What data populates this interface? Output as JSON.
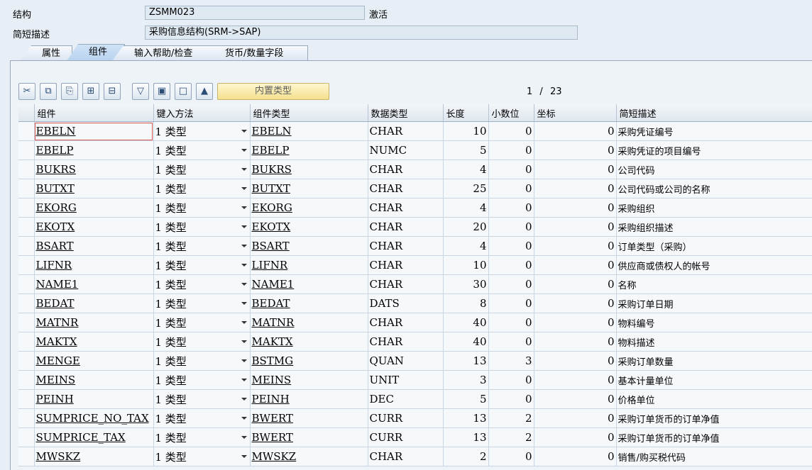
{
  "header": {
    "structure_label": "结构",
    "structure_value": "ZSMM023",
    "status": "激活",
    "desc_label": "简短描述",
    "desc_value": "采购信息结构(SRM->SAP)"
  },
  "tabs": [
    "属性",
    "组件",
    "输入帮助/检查",
    "货币/数量字段"
  ],
  "active_tab": "组件",
  "toolbar": {
    "icons": [
      "cut-icon",
      "copy-icon",
      "paste-icon",
      "insert-row-icon",
      "delete-row-icon",
      "filter-icon",
      "select-all-icon",
      "deselect-icon",
      "sort-icon"
    ],
    "builtin_type_label": "内置类型",
    "pager_current": "1",
    "pager_sep": "/",
    "pager_total": "23"
  },
  "columns": [
    "组件",
    "键入方法",
    "组件类型",
    "数据类型",
    "长度",
    "小数位",
    "坐标",
    "简短描述"
  ],
  "rows": [
    {
      "component": "EBELN",
      "method": "1 类型",
      "ctype": "EBELN",
      "dtype": "CHAR",
      "len": "10",
      "dec": "0",
      "coord": "0",
      "desc": "采购凭证编号"
    },
    {
      "component": "EBELP",
      "method": "1 类型",
      "ctype": "EBELP",
      "dtype": "NUMC",
      "len": "5",
      "dec": "0",
      "coord": "0",
      "desc": "采购凭证的项目编号"
    },
    {
      "component": "BUKRS",
      "method": "1 类型",
      "ctype": "BUKRS",
      "dtype": "CHAR",
      "len": "4",
      "dec": "0",
      "coord": "0",
      "desc": "公司代码"
    },
    {
      "component": "BUTXT",
      "method": "1 类型",
      "ctype": "BUTXT",
      "dtype": "CHAR",
      "len": "25",
      "dec": "0",
      "coord": "0",
      "desc": "公司代码或公司的名称"
    },
    {
      "component": "EKORG",
      "method": "1 类型",
      "ctype": "EKORG",
      "dtype": "CHAR",
      "len": "4",
      "dec": "0",
      "coord": "0",
      "desc": "采购组织"
    },
    {
      "component": "EKOTX",
      "method": "1 类型",
      "ctype": "EKOTX",
      "dtype": "CHAR",
      "len": "20",
      "dec": "0",
      "coord": "0",
      "desc": "采购组织描述"
    },
    {
      "component": "BSART",
      "method": "1 类型",
      "ctype": "BSART",
      "dtype": "CHAR",
      "len": "4",
      "dec": "0",
      "coord": "0",
      "desc": "订单类型（采购）"
    },
    {
      "component": "LIFNR",
      "method": "1 类型",
      "ctype": "LIFNR",
      "dtype": "CHAR",
      "len": "10",
      "dec": "0",
      "coord": "0",
      "desc": "供应商或债权人的帐号"
    },
    {
      "component": "NAME1",
      "method": "1 类型",
      "ctype": "NAME1",
      "dtype": "CHAR",
      "len": "30",
      "dec": "0",
      "coord": "0",
      "desc": "名称"
    },
    {
      "component": "BEDAT",
      "method": "1 类型",
      "ctype": "BEDAT",
      "dtype": "DATS",
      "len": "8",
      "dec": "0",
      "coord": "0",
      "desc": "采购订单日期"
    },
    {
      "component": "MATNR",
      "method": "1 类型",
      "ctype": "MATNR",
      "dtype": "CHAR",
      "len": "40",
      "dec": "0",
      "coord": "0",
      "desc": "物料编号"
    },
    {
      "component": "MAKTX",
      "method": "1 类型",
      "ctype": "MAKTX",
      "dtype": "CHAR",
      "len": "40",
      "dec": "0",
      "coord": "0",
      "desc": "物料描述"
    },
    {
      "component": "MENGE",
      "method": "1 类型",
      "ctype": "BSTMG",
      "dtype": "QUAN",
      "len": "13",
      "dec": "3",
      "coord": "0",
      "desc": "采购订单数量"
    },
    {
      "component": "MEINS",
      "method": "1 类型",
      "ctype": "MEINS",
      "dtype": "UNIT",
      "len": "3",
      "dec": "0",
      "coord": "0",
      "desc": "基本计量单位"
    },
    {
      "component": "PEINH",
      "method": "1 类型",
      "ctype": "PEINH",
      "dtype": "DEC",
      "len": "5",
      "dec": "0",
      "coord": "0",
      "desc": "价格单位"
    },
    {
      "component": "SUMPRICE_NO_TAX",
      "method": "1 类型",
      "ctype": "BWERT",
      "dtype": "CURR",
      "len": "13",
      "dec": "2",
      "coord": "0",
      "desc": "采购订单货币的订单净值"
    },
    {
      "component": "SUMPRICE_TAX",
      "method": "1 类型",
      "ctype": "BWERT",
      "dtype": "CURR",
      "len": "13",
      "dec": "2",
      "coord": "0",
      "desc": "采购订单货币的订单净值"
    },
    {
      "component": "MWSKZ",
      "method": "1 类型",
      "ctype": "MWSKZ",
      "dtype": "CHAR",
      "len": "2",
      "dec": "0",
      "coord": "0",
      "desc": "销售/购买税代码"
    }
  ]
}
